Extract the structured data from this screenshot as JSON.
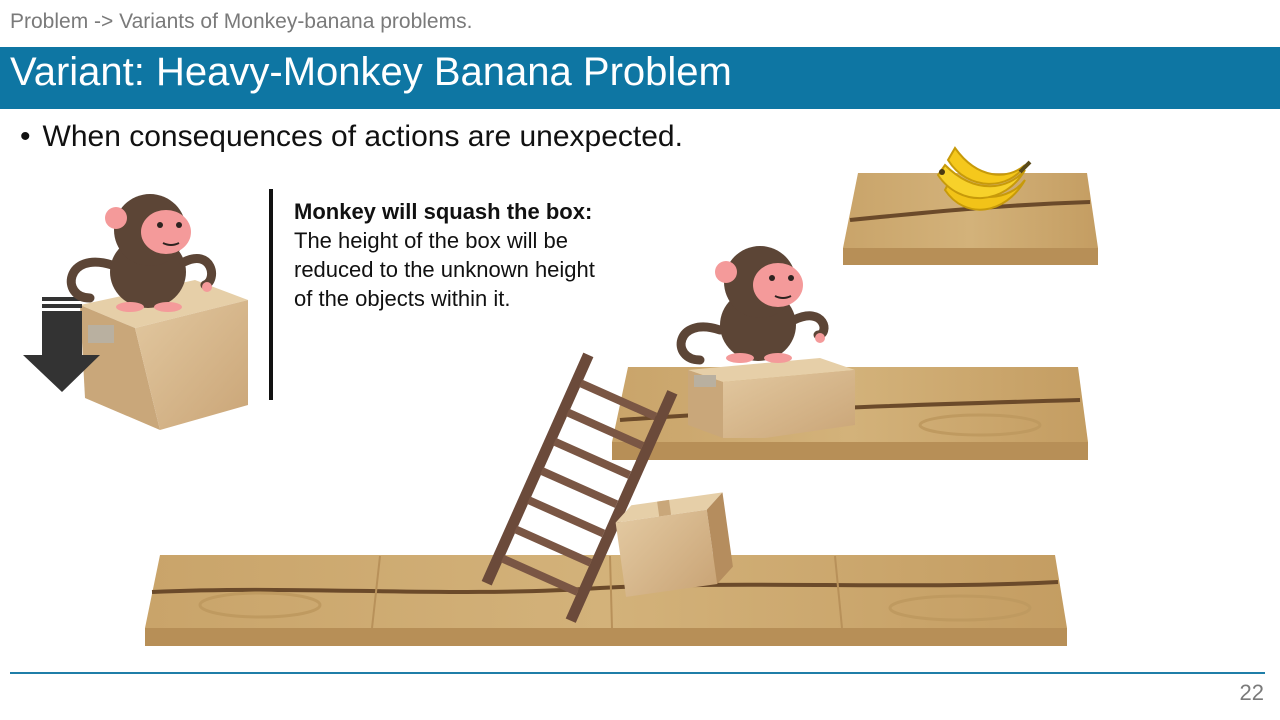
{
  "breadcrumb": "Problem -> Variants of Monkey-banana problems.",
  "title": "Variant: Heavy-Monkey Banana Problem",
  "bullet": "When consequences of actions are unexpected.",
  "note": {
    "heading": "Monkey will squash the box:",
    "body": "The height of the box will be reduced to the unknown height of the objects within it."
  },
  "page_number": "22",
  "icons": [
    "monkey-icon",
    "box-icon",
    "down-arrow-icon",
    "ladder-icon",
    "banana-icon",
    "wooden-platform"
  ],
  "colors": {
    "title_bar": "#0e76a3",
    "wood": "#c9a46a",
    "box": "#d8b98a",
    "monkey_fur": "#5c4536",
    "monkey_face": "#f49a9a",
    "ladder": "#6b4a3a",
    "banana": "#f5c518"
  }
}
